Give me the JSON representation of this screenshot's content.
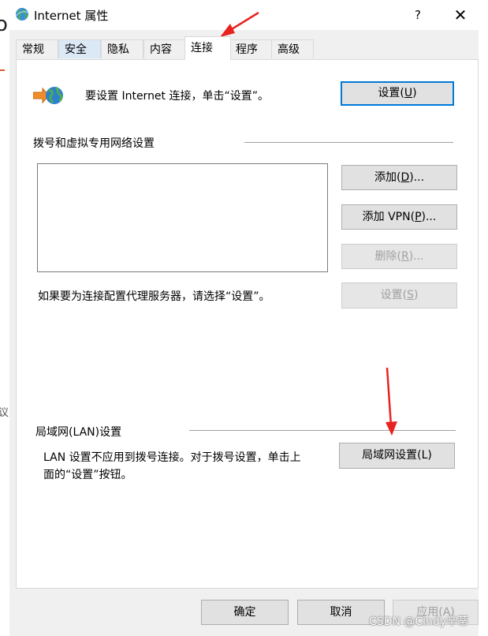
{
  "window": {
    "title": "Internet 属性",
    "help_label": "?",
    "close_label": "✕"
  },
  "tabs": [
    {
      "label": "常规"
    },
    {
      "label": "安全"
    },
    {
      "label": "隐私"
    },
    {
      "label": "内容"
    },
    {
      "label": "连接"
    },
    {
      "label": "程序"
    },
    {
      "label": "高级"
    }
  ],
  "active_tab": "连接",
  "setup": {
    "text": "要设置 Internet 连接，单击“设置”。",
    "button_prefix": "设置(",
    "button_key": "U",
    "button_suffix": ")"
  },
  "dialup": {
    "group_label": "拨号和虚拟专用网络设置",
    "add_prefix": "添加(",
    "add_key": "D",
    "add_suffix": ")...",
    "add_vpn_prefix": "添加 VPN(",
    "add_vpn_key": "P",
    "add_vpn_suffix": ")...",
    "remove_prefix": "删除(",
    "remove_key": "R",
    "remove_suffix": ")...",
    "proxy_text": "如果要为连接配置代理服务器，请选择“设置”。",
    "settings_prefix": "设置(",
    "settings_key": "S",
    "settings_suffix": ")"
  },
  "lan": {
    "group_label": "局域网(LAN)设置",
    "text_line1": "LAN 设置不应用到拨号连接。对于拨号设置，单击上",
    "text_line2": "面的“设置”按钮。",
    "button_label": "局域网设置(L)"
  },
  "footer": {
    "ok_label": "确定",
    "cancel_label": "取消",
    "apply_label": "应用(A)"
  },
  "watermark": "CSDN @Cindy辛蒂",
  "background": {
    "left_char": "o",
    "left_char2": "议"
  },
  "colors": {
    "accent": "#0078d7",
    "annotation_arrow": "#e8231f"
  }
}
